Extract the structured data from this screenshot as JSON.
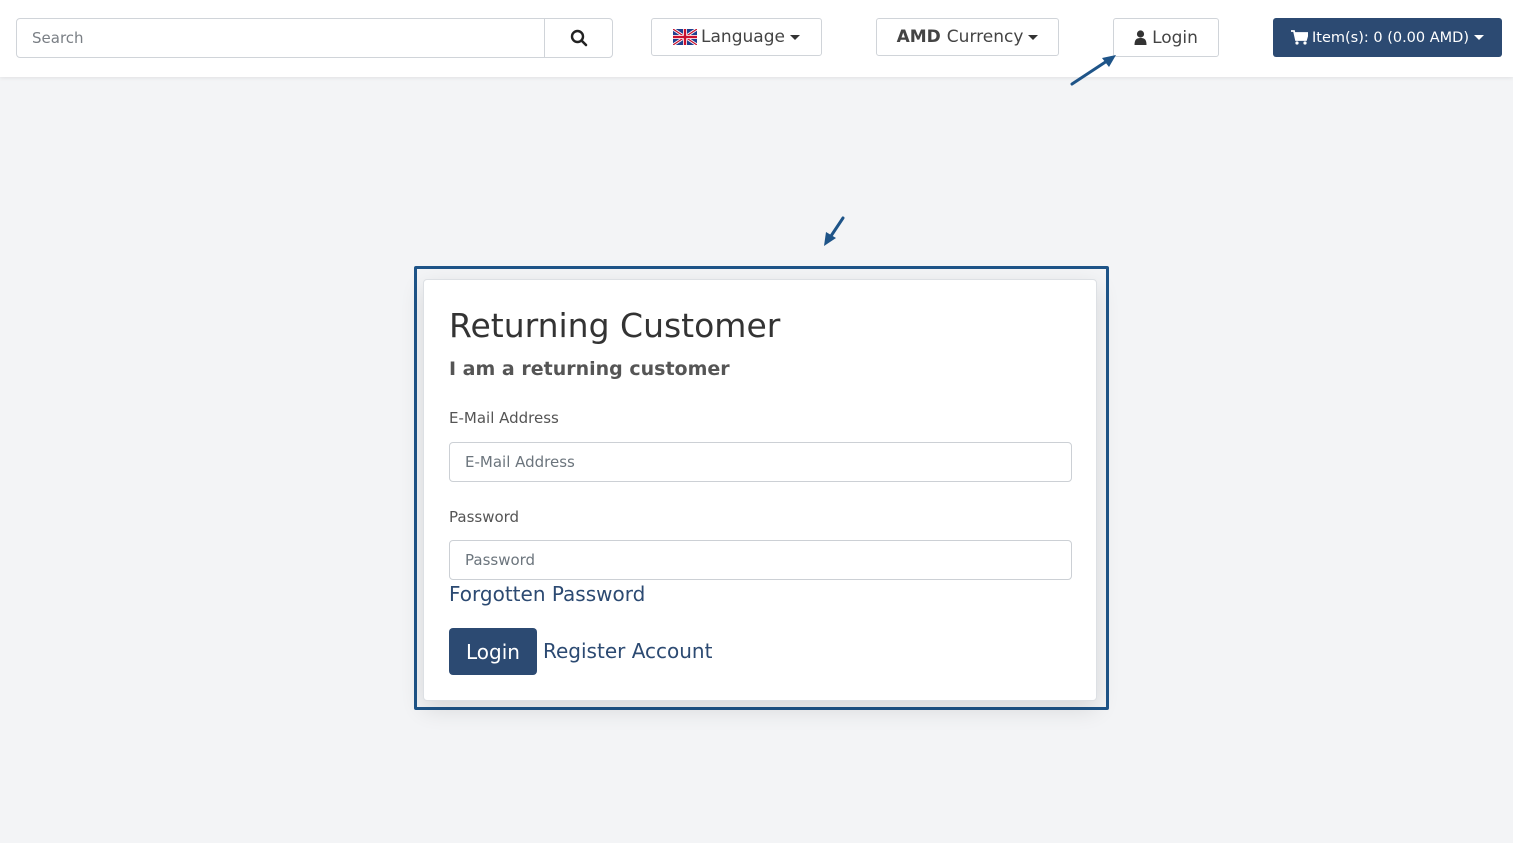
{
  "header": {
    "search": {
      "placeholder": "Search",
      "value": ""
    },
    "language": {
      "label": "Language"
    },
    "currency": {
      "code": "AMD",
      "label": "Currency"
    },
    "login": {
      "label": "Login"
    },
    "cart": {
      "label": "Item(s): 0 (0.00 AMD)"
    }
  },
  "login_panel": {
    "title": "Returning Customer",
    "subtitle": "I am a returning customer",
    "email": {
      "label": "E-Mail Address",
      "placeholder": "E-Mail Address",
      "value": ""
    },
    "password": {
      "label": "Password",
      "placeholder": "Password",
      "value": ""
    },
    "forgotten_link": "Forgotten Password",
    "login_button": "Login",
    "register_link": "Register Account"
  },
  "colors": {
    "primary": "#2c4a72",
    "annotation": "#1e5488",
    "page_background": "#f3f4f6"
  },
  "icons": [
    "search-icon",
    "uk-flag-icon",
    "user-icon",
    "shopping-cart-icon",
    "caret-down-icon"
  ]
}
